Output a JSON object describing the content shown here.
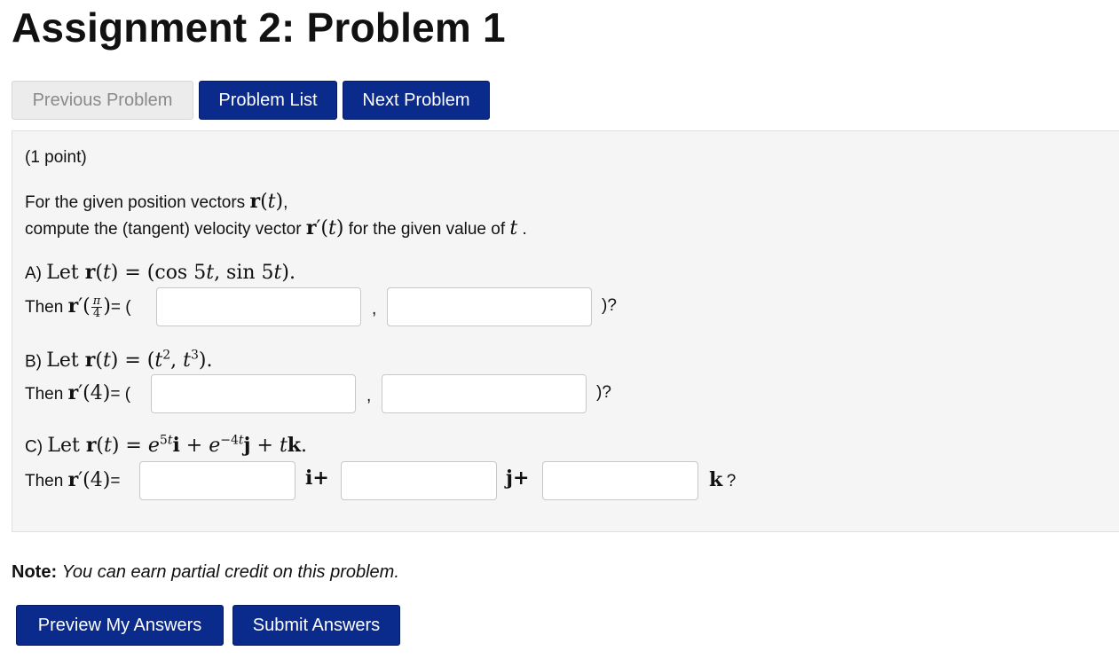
{
  "title": "Assignment 2: Problem 1",
  "nav": {
    "previous": "Previous Problem",
    "list": "Problem List",
    "next": "Next Problem"
  },
  "problem": {
    "points": "(1 point)",
    "intro_line1": "For the given position vectors",
    "intro_line1_math": "r(t)",
    "intro_line1_end": ",",
    "intro_line2_a": "compute the (tangent) velocity vector",
    "intro_line2_math": "r′(t)",
    "intro_line2_b": "for the given value of",
    "intro_line2_var": "t",
    "intro_line2_end": ".",
    "partA": {
      "prefix": "A)",
      "let": "Let r(t) = (cos 5t, sin 5t).",
      "then": "Then",
      "point_num": "π",
      "point_den": "4",
      "eq_open": "= (",
      "comma": ",",
      "close": ")?"
    },
    "partB": {
      "prefix": "B)",
      "let": "Let r(t) = (t², t³).",
      "then": "Then",
      "point": "r′(4)",
      "eq_open": "= (",
      "comma": ",",
      "close": ")?"
    },
    "partC": {
      "prefix": "C)",
      "let": "Let r(t) = e^5t i + e^−4t j + tk.",
      "then": "Then",
      "point": "r′(4)",
      "eq": "=",
      "i_label": "i+",
      "j_label": "j+",
      "k_label": "k",
      "q": "?"
    }
  },
  "note": {
    "label": "Note:",
    "text": "You can earn partial credit on this problem."
  },
  "actions": {
    "preview": "Preview My Answers",
    "submit": "Submit Answers"
  }
}
